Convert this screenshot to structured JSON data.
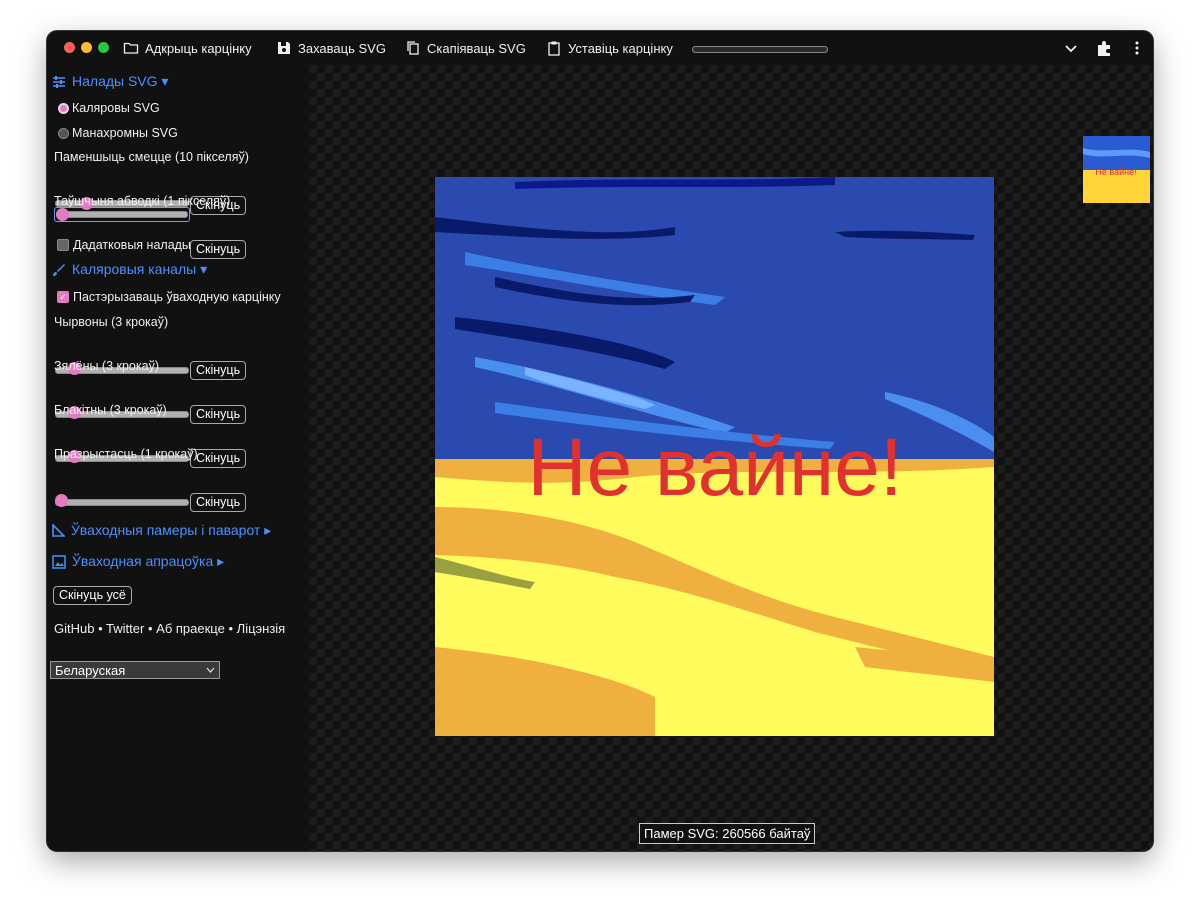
{
  "toolbar": {
    "open_label": "Адкрыць карцінку",
    "save_label": "Захаваць SVG",
    "copy_label": "Скапіяваць SVG",
    "paste_label": "Уставіць карцінку",
    "progress": 0
  },
  "svg_settings": {
    "title": "Налады SVG ▾",
    "color_svg": "Каляровы SVG",
    "mono_svg": "Манахромны SVG",
    "noise_label": "Паменшыць смецце (10 пікселяў)",
    "stroke_label": "Таўшчыня абводкі (1 пікселяў)",
    "advanced_label": "Дадатковыя налады"
  },
  "channels": {
    "title": "Каляровыя каналы ▾",
    "posterize_label": "Пастэрызаваць ўваходную карцінку",
    "red_label": "Чырвоны (3 крокаў)",
    "green_label": "Зялёны (3 крокаў)",
    "blue_label": "Блакітны (3 крокаў)",
    "alpha_label": "Празрыстасць (1 крокаў)"
  },
  "sections": {
    "size_rotate": "Ўваходныя памеры і паварот ▸",
    "preprocess": "Ўваходная апрацоўка ▸"
  },
  "reset_label": "Скінуць",
  "reset_all_label": "Скінуць усё",
  "links": {
    "github": "GitHub",
    "twitter": "Twitter",
    "about": "Аб праекце",
    "license": "Ліцэнзія",
    "sep": "•"
  },
  "language": "Беларуская",
  "image_text": "Не вайне!",
  "thumb_text": "Не вайне!",
  "status": "Памер SVG: 260566 байтаў",
  "colors": {
    "accent": "#4a90ff",
    "slider_thumb": "#e37bc1",
    "flag_blue": "#2040a8",
    "flag_yellow": "#fffb5c",
    "text_red": "#e03030"
  }
}
